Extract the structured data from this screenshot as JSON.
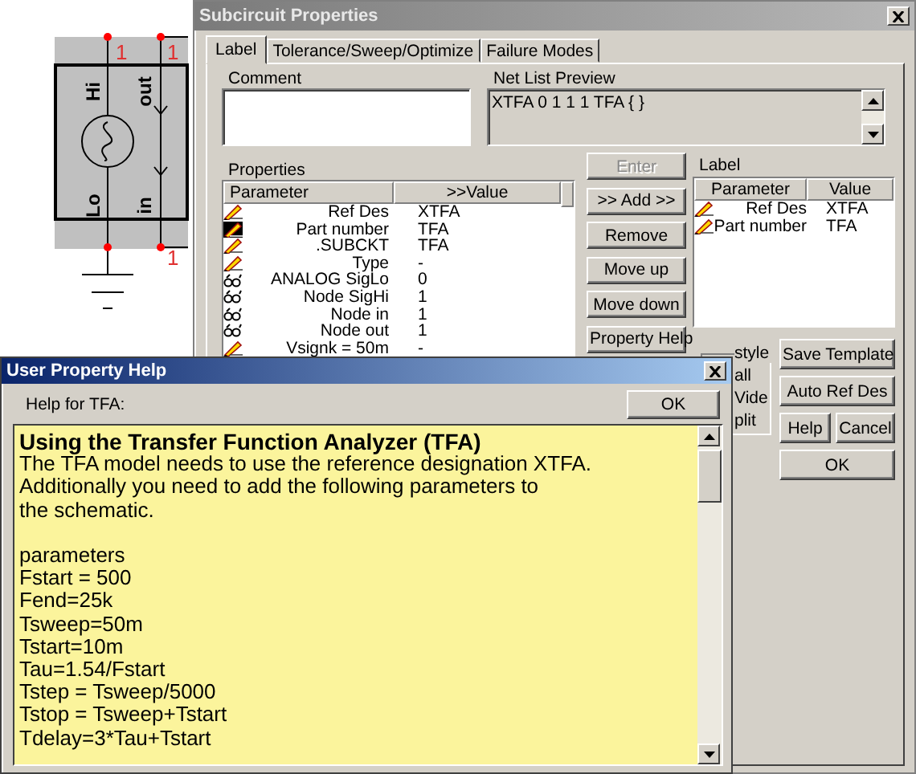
{
  "schematic": {
    "pins": [
      {
        "name": "Hi",
        "node": "1"
      },
      {
        "name": "out",
        "node": "1"
      },
      {
        "name": "Lo"
      },
      {
        "name": "in",
        "node": "1"
      }
    ]
  },
  "properties_window": {
    "title": "Subcircuit Properties",
    "tabs": [
      {
        "label": "Label",
        "selected": true
      },
      {
        "label": "Tolerance/Sweep/Optimize",
        "selected": false
      },
      {
        "label": "Failure Modes",
        "selected": false
      }
    ],
    "comment": {
      "label": "Comment"
    },
    "net_list_preview": {
      "label": "Net List Preview",
      "value": "XTFA 0 1 1 1 TFA { }"
    },
    "properties": {
      "label": "Properties",
      "columns": [
        "Parameter",
        ">>Value"
      ],
      "rows": [
        {
          "kind": "editable",
          "parameter": "Ref Des",
          "value": "XTFA",
          "selected": false
        },
        {
          "kind": "editable",
          "parameter": "Part number",
          "value": "TFA",
          "selected": true
        },
        {
          "kind": "editable",
          "parameter": ".SUBCKT",
          "value": "TFA",
          "selected": false
        },
        {
          "kind": "editable",
          "parameter": "Type",
          "value": "-",
          "selected": false
        },
        {
          "kind": "viewable",
          "parameter": "ANALOG SigLo",
          "value": "0",
          "selected": false
        },
        {
          "kind": "viewable",
          "parameter": "Node SigHi",
          "value": "1",
          "selected": false
        },
        {
          "kind": "viewable",
          "parameter": "Node in",
          "value": "1",
          "selected": false
        },
        {
          "kind": "viewable",
          "parameter": "Node out",
          "value": "1",
          "selected": false
        },
        {
          "kind": "editable",
          "parameter": "Vsignk = 50m",
          "value": "-",
          "selected": false
        }
      ]
    },
    "buttons": [
      {
        "label": "Enter",
        "disabled": true
      },
      {
        "label": ">> Add >>",
        "disabled": false
      },
      {
        "label": "Remove",
        "disabled": false
      },
      {
        "label": "Move up",
        "disabled": false
      },
      {
        "label": "Move down",
        "disabled": false
      },
      {
        "label": "Property Help",
        "disabled": false
      }
    ],
    "label_list": {
      "label": "Label",
      "columns": [
        "Parameter",
        "Value"
      ],
      "rows": [
        {
          "kind": "editable",
          "parameter": "Ref Des",
          "value": "XTFA"
        },
        {
          "kind": "editable",
          "parameter": "Part number",
          "value": "TFA"
        }
      ]
    },
    "style_group": {
      "label": "style",
      "options": [
        "all",
        "Vide",
        "plit"
      ]
    },
    "action_buttons": [
      "Save Template",
      "Auto Ref Des",
      "Help",
      "Cancel",
      "OK"
    ]
  },
  "help_window": {
    "title": "User Property Help",
    "label": "Help for TFA:",
    "ok": "OK",
    "heading": "Using the Transfer Function Analyzer (TFA)",
    "paragraphs": [
      [
        "The TFA model needs to use the reference designation XTFA.",
        "Additionally you need to add the following parameters to",
        "the schematic."
      ],
      [
        "parameters",
        "Fstart = 500",
        "Fend=25k",
        "Tsweep=50m",
        "Tstart=10m",
        "Tau=1.54/Fstart",
        "Tstep = Tsweep/5000",
        "Tstop = Tsweep+Tstart",
        "Tdelay=3*Tau+Tstart"
      ]
    ]
  }
}
